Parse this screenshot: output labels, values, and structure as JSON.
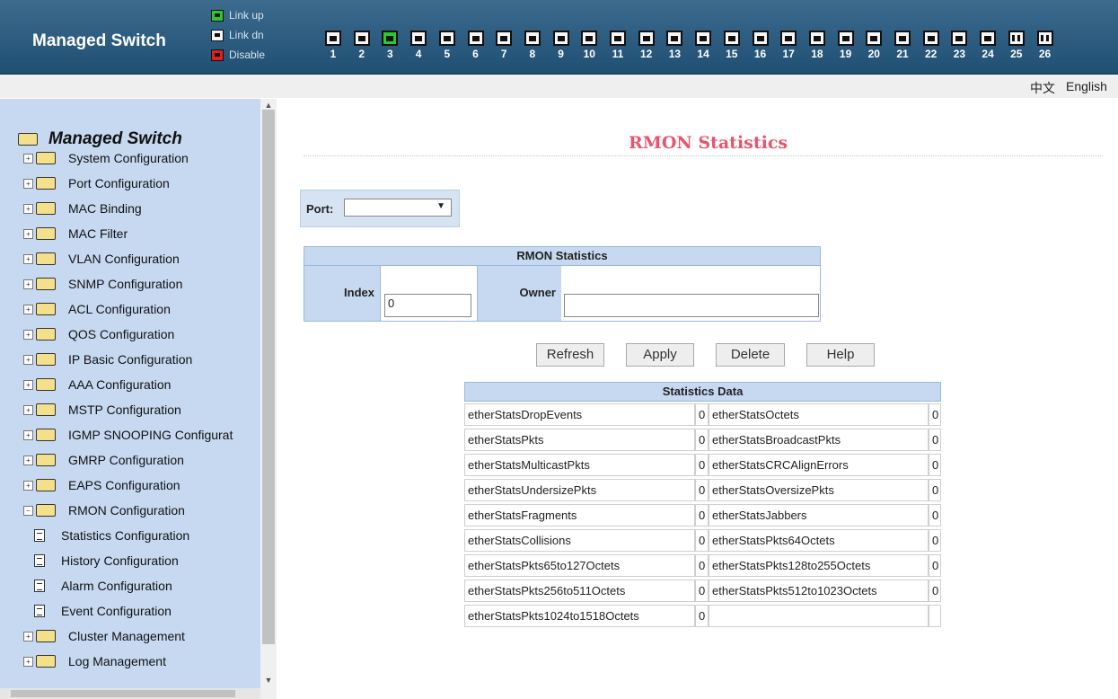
{
  "header": {
    "brand": "Managed Switch",
    "legend": [
      {
        "label": "Link up",
        "color": "#2ec82e"
      },
      {
        "label": "Link dn",
        "color": "#f5f5f5"
      },
      {
        "label": "Disable",
        "color": "#e02020"
      }
    ],
    "ports": [
      {
        "num": "1",
        "state": "down"
      },
      {
        "num": "2",
        "state": "down"
      },
      {
        "num": "3",
        "state": "up"
      },
      {
        "num": "4",
        "state": "down"
      },
      {
        "num": "5",
        "state": "down"
      },
      {
        "num": "6",
        "state": "down"
      },
      {
        "num": "7",
        "state": "down"
      },
      {
        "num": "8",
        "state": "down"
      },
      {
        "num": "9",
        "state": "down"
      },
      {
        "num": "10",
        "state": "down"
      },
      {
        "num": "11",
        "state": "down"
      },
      {
        "num": "12",
        "state": "down"
      },
      {
        "num": "13",
        "state": "down"
      },
      {
        "num": "14",
        "state": "down"
      },
      {
        "num": "15",
        "state": "down"
      },
      {
        "num": "16",
        "state": "down"
      },
      {
        "num": "17",
        "state": "down"
      },
      {
        "num": "18",
        "state": "down"
      },
      {
        "num": "19",
        "state": "down"
      },
      {
        "num": "20",
        "state": "down"
      },
      {
        "num": "21",
        "state": "down"
      },
      {
        "num": "22",
        "state": "down"
      },
      {
        "num": "23",
        "state": "down"
      },
      {
        "num": "24",
        "state": "down"
      },
      {
        "num": "25",
        "state": "fiber"
      },
      {
        "num": "26",
        "state": "fiber"
      }
    ]
  },
  "lang": {
    "chinese": "中文",
    "english": "English"
  },
  "sidebar": {
    "root": "Managed Switch",
    "items": [
      {
        "label": "System Configuration",
        "kind": "folder"
      },
      {
        "label": "Port Configuration",
        "kind": "folder"
      },
      {
        "label": "MAC Binding",
        "kind": "folder"
      },
      {
        "label": "MAC Filter",
        "kind": "folder"
      },
      {
        "label": "VLAN Configuration",
        "kind": "folder"
      },
      {
        "label": "SNMP Configuration",
        "kind": "folder"
      },
      {
        "label": "ACL Configuration",
        "kind": "folder"
      },
      {
        "label": "QOS Configuration",
        "kind": "folder"
      },
      {
        "label": "IP Basic Configuration",
        "kind": "folder"
      },
      {
        "label": "AAA Configuration",
        "kind": "folder"
      },
      {
        "label": "MSTP Configuration",
        "kind": "folder"
      },
      {
        "label": "IGMP SNOOPING Configurat",
        "kind": "folder"
      },
      {
        "label": "GMRP Configuration",
        "kind": "folder"
      },
      {
        "label": "EAPS Configuration",
        "kind": "folder"
      },
      {
        "label": "RMON Configuration",
        "kind": "open-folder"
      },
      {
        "label": "Statistics Configuration",
        "kind": "page"
      },
      {
        "label": "History Configuration",
        "kind": "page"
      },
      {
        "label": "Alarm Configuration",
        "kind": "page"
      },
      {
        "label": "Event Configuration",
        "kind": "page"
      },
      {
        "label": "Cluster Management",
        "kind": "folder"
      },
      {
        "label": "Log Management",
        "kind": "folder"
      }
    ]
  },
  "main": {
    "title": "RMON Statistics",
    "port_label": "Port:",
    "port_value": "",
    "rmon_header": "RMON Statistics",
    "index_label": "Index",
    "index_value": "0",
    "owner_label": "Owner",
    "owner_value": "",
    "buttons": {
      "refresh": "Refresh",
      "apply": "Apply",
      "delete": "Delete",
      "help": "Help"
    },
    "stats_header": "Statistics Data",
    "stats": [
      [
        "etherStatsDropEvents",
        "0",
        "etherStatsOctets",
        "0"
      ],
      [
        "etherStatsPkts",
        "0",
        "etherStatsBroadcastPkts",
        "0"
      ],
      [
        "etherStatsMulticastPkts",
        "0",
        "etherStatsCRCAlignErrors",
        "0"
      ],
      [
        "etherStatsUndersizePkts",
        "0",
        "etherStatsOversizePkts",
        "0"
      ],
      [
        "etherStatsFragments",
        "0",
        "etherStatsJabbers",
        "0"
      ],
      [
        "etherStatsCollisions",
        "0",
        "etherStatsPkts64Octets",
        "0"
      ],
      [
        "etherStatsPkts65to127Octets",
        "0",
        "etherStatsPkts128to255Octets",
        "0"
      ],
      [
        "etherStatsPkts256to511Octets",
        "0",
        "etherStatsPkts512to1023Octets",
        "0"
      ],
      [
        "etherStatsPkts1024to1518Octets",
        "0",
        "",
        ""
      ]
    ]
  }
}
